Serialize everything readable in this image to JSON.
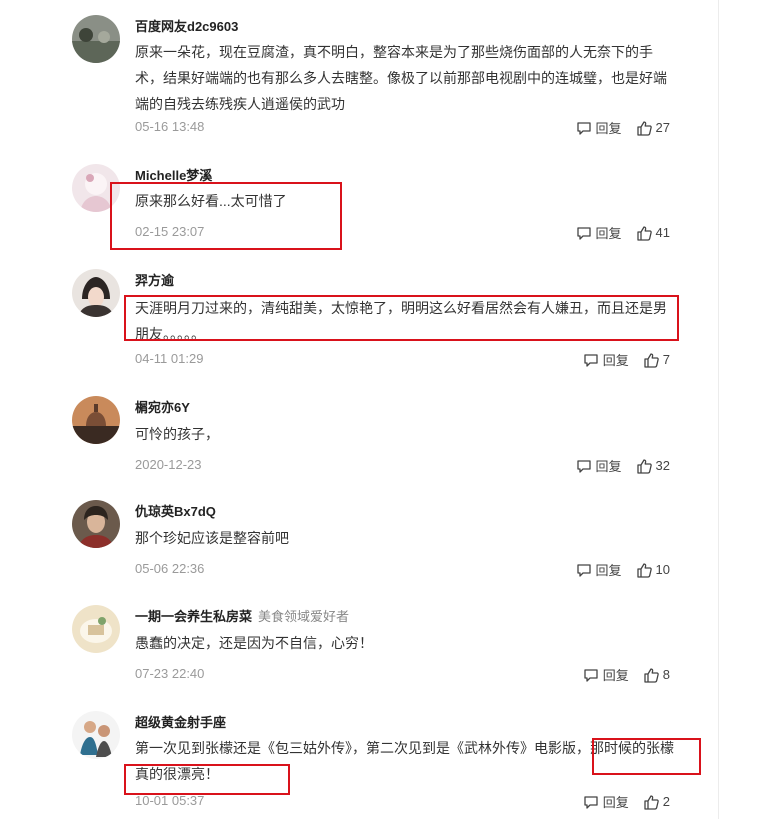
{
  "labels": {
    "reply": "回复"
  },
  "comments": [
    {
      "user": "百度网友d2c9603",
      "tag": "",
      "text": "原来一朵花，现在豆腐渣，真不明白，整容本来是为了那些烧伤面部的人无奈下的手术，结果好端端的也有那么多人去瞎整。像极了以前那部电视剧中的连城璧，也是好端端的自残去练残疾人逍遥侯的武功",
      "time": "05-16 13:48",
      "likes": "27"
    },
    {
      "user": "Michelle梦溪",
      "tag": "",
      "text": "原来那么好看...太可惜了",
      "time": "02-15 23:07",
      "likes": "41"
    },
    {
      "user": "羿方逾",
      "tag": "",
      "text": "天涯明月刀过来的，清纯甜美，太惊艳了，明明这么好看居然会有人嫌丑，而且还是男朋友。。。。。",
      "time": "04-11 01:29",
      "likes": "7"
    },
    {
      "user": "榍宛亦6Y",
      "tag": "",
      "text": "可怜的孩子，",
      "time": "2020-12-23",
      "likes": "32"
    },
    {
      "user": "仇琼英Bx7dQ",
      "tag": "",
      "text": "那个珍妃应该是整容前吧",
      "time": "05-06 22:36",
      "likes": "10"
    },
    {
      "user": "一期一会养生私房菜",
      "tag": "美食领域爱好者",
      "text": "愚蠢的决定，还是因为不自信，心穷！",
      "time": "07-23 22:40",
      "likes": "8"
    },
    {
      "user": "超级黄金射手座",
      "tag": "",
      "text": "第一次见到张檬还是《包三姑外传》，第二次见到是《武林外传》电影版，那时候的张檬真的很漂亮！",
      "time": "10-01 05:37",
      "likes": "2"
    }
  ]
}
